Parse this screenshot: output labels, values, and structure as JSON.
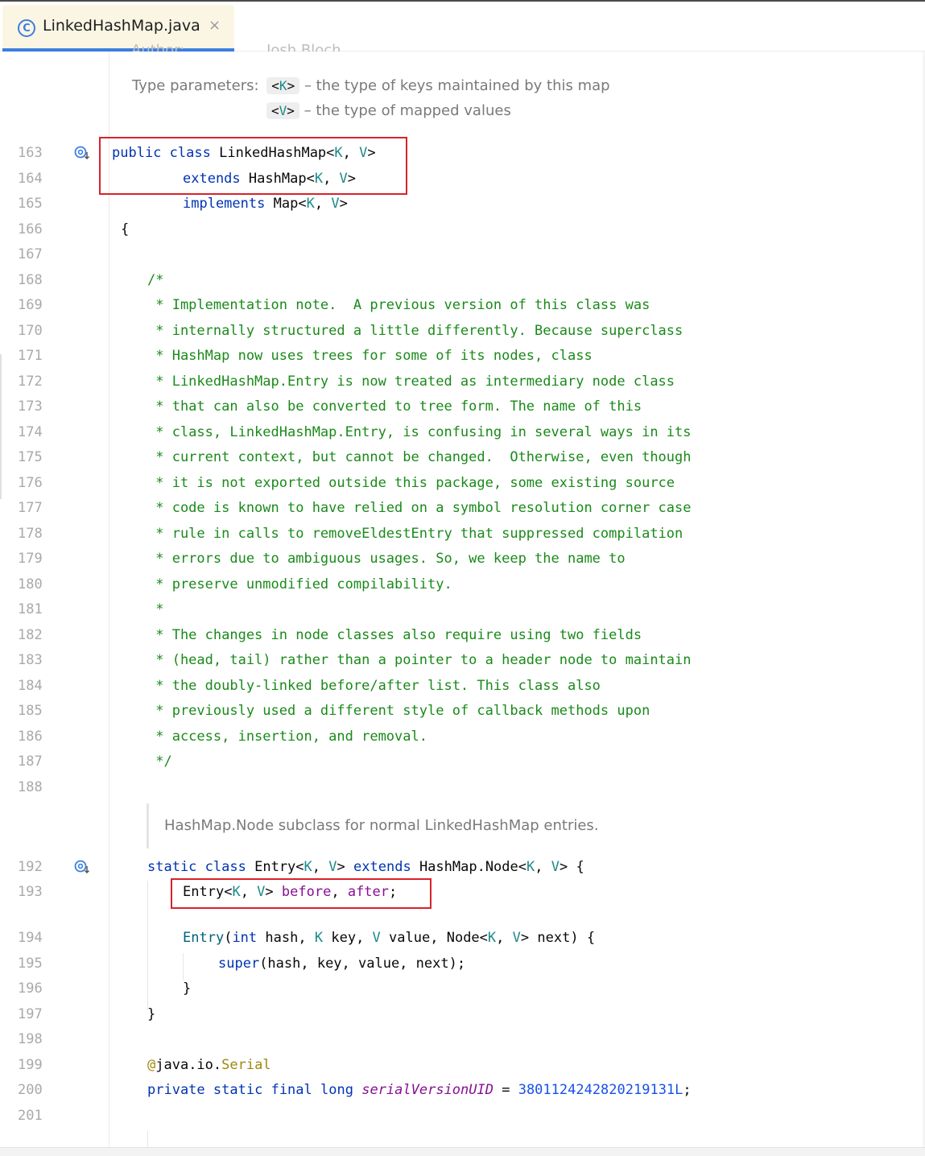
{
  "tab": {
    "title": "LinkedHashMap.java",
    "icon": "C",
    "close": "×"
  },
  "doc": {
    "author_label": "Author:",
    "author_value": "Josh Bloch",
    "type_params_label": "Type parameters:",
    "param_k": "K",
    "param_k_desc": "– the type of keys maintained by this map",
    "param_v": "V",
    "param_v_desc": "– the type of mapped values",
    "entry_doc": "HashMap.Node subclass for normal LinkedHashMap entries."
  },
  "line_numbers": {
    "l163": "163",
    "l164": "164",
    "l165": "165",
    "l166": "166",
    "l167": "167",
    "l168": "168",
    "l169": "169",
    "l170": "170",
    "l171": "171",
    "l172": "172",
    "l173": "173",
    "l174": "174",
    "l175": "175",
    "l176": "176",
    "l177": "177",
    "l178": "178",
    "l179": "179",
    "l180": "180",
    "l181": "181",
    "l182": "182",
    "l183": "183",
    "l184": "184",
    "l185": "185",
    "l186": "186",
    "l187": "187",
    "l188": "188",
    "l192": "192",
    "l193": "193",
    "l194": "194",
    "l195": "195",
    "l196": "196",
    "l197": "197",
    "l198": "198",
    "l199": "199",
    "l200": "200",
    "l201": "201"
  },
  "comment_lines": [
    "/*",
    " * Implementation note.  A previous version of this class was",
    " * internally structured a little differently. Because superclass",
    " * HashMap now uses trees for some of its nodes, class",
    " * LinkedHashMap.Entry is now treated as intermediary node class",
    " * that can also be converted to tree form. The name of this",
    " * class, LinkedHashMap.Entry, is confusing in several ways in its",
    " * current context, but cannot be changed.  Otherwise, even though",
    " * it is not exported outside this package, some existing source",
    " * code is known to have relied on a symbol resolution corner case",
    " * rule in calls to removeEldestEntry that suppressed compilation",
    " * errors due to ambiguous usages. So, we keep the name to",
    " * preserve unmodified compilability.",
    " *",
    " * The changes in node classes also require using two fields",
    " * (head, tail) rather than a pointer to a header node to maintain",
    " * the doubly-linked before/after list. This class also",
    " * previously used a different style of callback methods upon",
    " * access, insertion, and removal.",
    " */"
  ],
  "tokens": {
    "public": "public",
    "class": "class",
    "static": "static",
    "extends": "extends",
    "implements": "implements",
    "private": "private",
    "final": "final",
    "long": "long",
    "int": "int",
    "super": "super",
    "LinkedHashMap": "LinkedHashMap",
    "HashMap": "HashMap",
    "Map": "Map",
    "K": "K",
    "V": "V",
    "lt": "<",
    "gt": ">",
    "comma": ", ",
    "lbrace": "{",
    "rbrace": "}",
    "Entry": "Entry",
    "HashMapNode": "HashMap.Node",
    "Node": "Node",
    "before": "before",
    "after": "after",
    "semi": ";",
    "hash": "hash",
    "key": "key",
    "value": "value",
    "next": "next",
    "lparen": "(",
    "rparen": ")",
    "super_args": "(hash, key, value, next);",
    "at": "@",
    "java_io": "java.io.",
    "Serial": "Serial",
    "serialVersionUID": "serialVersionUID",
    "eq": " = ",
    "serial_value": "3801124242820219131L"
  }
}
